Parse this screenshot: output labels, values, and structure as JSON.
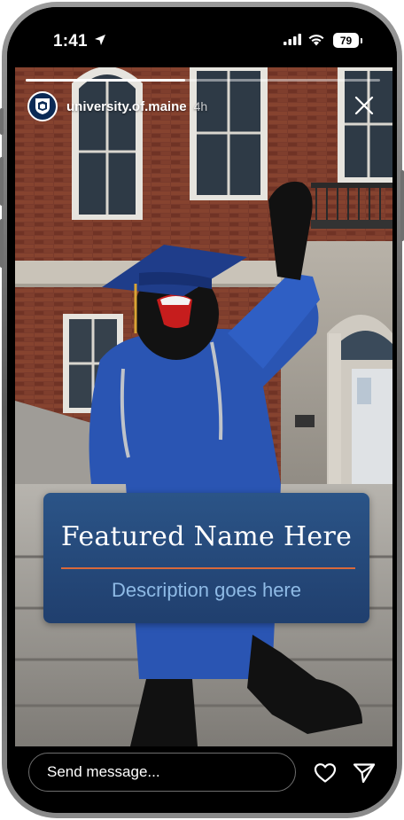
{
  "status_bar": {
    "time": "1:41",
    "battery_level": "79",
    "icons": [
      "location-arrow-icon",
      "signal-bars-icon",
      "wifi-icon",
      "battery-icon"
    ]
  },
  "story": {
    "progress_fraction": 0.45,
    "account": {
      "username": "university.of.maine",
      "post_age": "4h",
      "avatar_icon": "university-shield-icon"
    },
    "close_icon": "close-icon",
    "feature_card": {
      "name": "Featured Name Here",
      "description": "Description goes here",
      "rule_color": "#d9693a",
      "card_color": "#24487a"
    }
  },
  "message_bar": {
    "placeholder": "Send message...",
    "icons": [
      "heart-icon",
      "send-icon"
    ]
  }
}
